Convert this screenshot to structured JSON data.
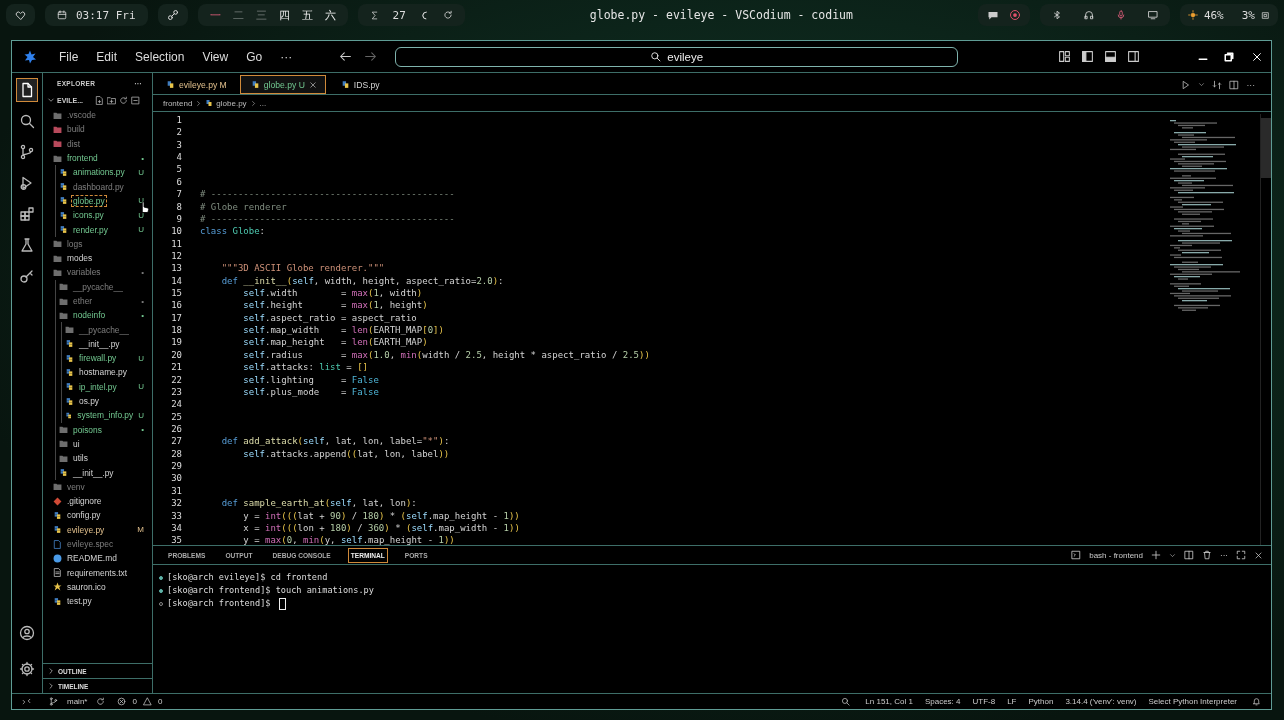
{
  "desktop_bar": {
    "clock": "03:17 Fri",
    "workspaces": [
      {
        "label": "一",
        "selected": true,
        "occupied": true
      },
      {
        "label": "二",
        "selected": false,
        "occupied": false
      },
      {
        "label": "三",
        "selected": false,
        "occupied": false
      },
      {
        "label": "四",
        "selected": false,
        "occupied": true
      },
      {
        "label": "五",
        "selected": false,
        "occupied": true
      },
      {
        "label": "六",
        "selected": false,
        "occupied": true
      }
    ],
    "counter": "27",
    "window_title": "globe.py - evileye - VSCodium - codium",
    "battery": "46%",
    "cpu": "3%"
  },
  "menu": [
    "File",
    "Edit",
    "Selection",
    "View",
    "Go",
    "···"
  ],
  "command_center": {
    "value": "evileye"
  },
  "activity_bar": [
    {
      "kind": "files",
      "selected": true
    },
    {
      "kind": "search",
      "selected": false
    },
    {
      "kind": "source-control",
      "selected": false
    },
    {
      "kind": "run",
      "selected": false
    },
    {
      "kind": "extensions",
      "selected": false
    },
    {
      "kind": "testing",
      "selected": false
    },
    {
      "kind": "remote",
      "selected": false
    }
  ],
  "activity_bar_bottom": [
    {
      "kind": "account"
    },
    {
      "kind": "settings"
    }
  ],
  "explorer": {
    "title": "EXPLORER",
    "more": "···",
    "root": "EVILE...",
    "tree": [
      {
        "name": ".vscode",
        "kind": "folder",
        "ignored": true,
        "untracked": false,
        "modified": false,
        "selected": false
      },
      {
        "name": "build",
        "kind": "buildfolder",
        "ignored": true,
        "untracked": false,
        "modified": false,
        "selected": false
      },
      {
        "name": "dist",
        "kind": "buildfolder",
        "ignored": true,
        "untracked": false,
        "modified": false,
        "selected": false
      },
      {
        "name": "frontend",
        "kind": "folder",
        "ignored": false,
        "untracked": true,
        "modified": false,
        "status": "•",
        "selected": false,
        "children": [
          {
            "name": "animations.py",
            "kind": "python",
            "ignored": false,
            "untracked": true,
            "modified": false,
            "status": "U",
            "selected": false
          },
          {
            "name": "dashboard.py",
            "kind": "python",
            "ignored": true,
            "untracked": false,
            "modified": false,
            "selected": false
          },
          {
            "name": "globe.py",
            "kind": "python",
            "ignored": false,
            "untracked": true,
            "modified": false,
            "status": "U",
            "selected": true
          },
          {
            "name": "icons.py",
            "kind": "python",
            "ignored": false,
            "untracked": true,
            "modified": false,
            "status": "U",
            "selected": false
          },
          {
            "name": "render.py",
            "kind": "python",
            "ignored": false,
            "untracked": true,
            "modified": false,
            "status": "U",
            "selected": false
          }
        ]
      },
      {
        "name": "logs",
        "kind": "folder",
        "ignored": true,
        "untracked": false,
        "modified": false,
        "selected": false
      },
      {
        "name": "modes",
        "kind": "folder",
        "ignored": false,
        "untracked": false,
        "modified": false,
        "selected": false
      },
      {
        "name": "variables",
        "kind": "folder",
        "ignored": true,
        "untracked": false,
        "modified": false,
        "status": "•",
        "selected": false,
        "children": [
          {
            "name": "__pycache__",
            "kind": "folder",
            "ignored": true,
            "untracked": false,
            "modified": false,
            "selected": false
          },
          {
            "name": "ether",
            "kind": "folder",
            "ignored": true,
            "untracked": false,
            "modified": false,
            "status": "•",
            "selected": false
          },
          {
            "name": "nodeinfo",
            "kind": "folder",
            "ignored": false,
            "untracked": true,
            "modified": false,
            "status": "•",
            "selected": false,
            "children": [
              {
                "name": "__pycache__",
                "kind": "folder",
                "ignored": true,
                "untracked": false,
                "modified": false,
                "selected": false
              },
              {
                "name": "__init__.py",
                "kind": "python",
                "ignored": false,
                "untracked": false,
                "modified": false,
                "selected": false
              },
              {
                "name": "firewall.py",
                "kind": "python",
                "ignored": false,
                "untracked": true,
                "modified": false,
                "status": "U",
                "selected": false
              },
              {
                "name": "hostname.py",
                "kind": "python",
                "ignored": false,
                "untracked": false,
                "modified": false,
                "selected": false
              },
              {
                "name": "ip_intel.py",
                "kind": "python",
                "ignored": false,
                "untracked": true,
                "modified": false,
                "status": "U",
                "selected": false
              },
              {
                "name": "os.py",
                "kind": "python",
                "ignored": false,
                "untracked": false,
                "modified": false,
                "selected": false
              },
              {
                "name": "system_info.py",
                "kind": "python",
                "ignored": false,
                "untracked": true,
                "modified": false,
                "status": "U",
                "selected": false
              }
            ]
          },
          {
            "name": "poisons",
            "kind": "folder",
            "ignored": false,
            "untracked": true,
            "modified": false,
            "status": "•",
            "selected": false
          },
          {
            "name": "ui",
            "kind": "folder",
            "ignored": false,
            "untracked": false,
            "modified": false,
            "selected": false
          },
          {
            "name": "utils",
            "kind": "folder",
            "ignored": false,
            "untracked": false,
            "modified": false,
            "selected": false
          },
          {
            "name": "__init__.py",
            "kind": "python",
            "ignored": false,
            "untracked": false,
            "modified": false,
            "selected": false
          }
        ]
      },
      {
        "name": "venv",
        "kind": "folder",
        "ignored": true,
        "untracked": false,
        "modified": false,
        "selected": false
      },
      {
        "name": ".gitignore",
        "kind": "git",
        "ignored": false,
        "untracked": false,
        "modified": false,
        "selected": false
      },
      {
        "name": "config.py",
        "kind": "python",
        "ignored": false,
        "untracked": false,
        "modified": false,
        "selected": false
      },
      {
        "name": "evileye.py",
        "kind": "python",
        "ignored": false,
        "untracked": false,
        "modified": true,
        "status": "M",
        "selected": false
      },
      {
        "name": "evileye.spec",
        "kind": "spec",
        "ignored": true,
        "untracked": false,
        "modified": false,
        "selected": false
      },
      {
        "name": "README.md",
        "kind": "markdown",
        "ignored": false,
        "untracked": false,
        "modified": false,
        "selected": false
      },
      {
        "name": "requirements.txt",
        "kind": "text",
        "ignored": false,
        "untracked": false,
        "modified": false,
        "selected": false
      },
      {
        "name": "sauron.ico",
        "kind": "image",
        "ignored": false,
        "untracked": false,
        "modified": false,
        "selected": false
      },
      {
        "name": "test.py",
        "kind": "python",
        "ignored": false,
        "untracked": false,
        "modified": false,
        "selected": false
      }
    ],
    "sections": [
      {
        "label": "OUTLINE",
        "expanded": false
      },
      {
        "label": "TIMELINE",
        "expanded": false
      }
    ]
  },
  "tabs": [
    {
      "label": "evileye.py",
      "status": "M",
      "untracked": false,
      "modified": true,
      "selected": false
    },
    {
      "label": "globe.py",
      "status": "U",
      "untracked": true,
      "modified": false,
      "selected": true
    },
    {
      "label": "IDS.py",
      "untracked": false,
      "modified": false,
      "selected": false
    }
  ],
  "breadcrumb": [
    "frontend",
    "globe.py",
    "..."
  ],
  "code": [
    {
      "n": "1"
    },
    {
      "n": "2"
    },
    {
      "n": "3"
    },
    {
      "n": "4"
    },
    {
      "n": "5"
    },
    {
      "n": "6"
    },
    {
      "n": "7",
      "tokens": [
        {
          "kind": "comment",
          "text": "# ---------------------------------------------"
        }
      ]
    },
    {
      "n": "8",
      "tokens": [
        {
          "kind": "comment",
          "text": "# Globe renderer"
        }
      ]
    },
    {
      "n": "9",
      "tokens": [
        {
          "kind": "comment",
          "text": "# ---------------------------------------------"
        }
      ]
    },
    {
      "n": "10",
      "tokens": [
        {
          "kind": "keyword",
          "text": "class "
        },
        {
          "kind": "class",
          "text": "Globe"
        },
        {
          "kind": "plain",
          "text": ":"
        }
      ]
    },
    {
      "n": "11"
    },
    {
      "n": "12"
    },
    {
      "n": "13",
      "tokens": [
        {
          "kind": "string",
          "text": "    \"\"\"3D ASCII Globe renderer.\"\"\""
        }
      ]
    },
    {
      "n": "14",
      "tokens": [
        {
          "kind": "keyword",
          "text": "    def "
        },
        {
          "kind": "function",
          "text": "__init__"
        },
        {
          "kind": "bracket",
          "text": "("
        },
        {
          "kind": "self",
          "text": "self"
        },
        {
          "kind": "plain",
          "text": ", width, height, aspect_ratio="
        },
        {
          "kind": "number",
          "text": "2.0"
        },
        {
          "kind": "bracket",
          "text": ")"
        },
        {
          "kind": "plain",
          "text": ":"
        }
      ]
    },
    {
      "n": "15",
      "tokens": [
        {
          "kind": "self",
          "text": "        self"
        },
        {
          "kind": "plain",
          "text": ".width        = "
        },
        {
          "kind": "builtin",
          "text": "max"
        },
        {
          "kind": "bracket",
          "text": "("
        },
        {
          "kind": "number",
          "text": "1"
        },
        {
          "kind": "plain",
          "text": ", width"
        },
        {
          "kind": "bracket",
          "text": ")"
        }
      ]
    },
    {
      "n": "16",
      "tokens": [
        {
          "kind": "self",
          "text": "        self"
        },
        {
          "kind": "plain",
          "text": ".height       = "
        },
        {
          "kind": "builtin",
          "text": "max"
        },
        {
          "kind": "bracket",
          "text": "("
        },
        {
          "kind": "number",
          "text": "1"
        },
        {
          "kind": "plain",
          "text": ", height"
        },
        {
          "kind": "bracket",
          "text": ")"
        }
      ]
    },
    {
      "n": "17",
      "tokens": [
        {
          "kind": "self",
          "text": "        self"
        },
        {
          "kind": "plain",
          "text": ".aspect_ratio = aspect_ratio"
        }
      ]
    },
    {
      "n": "18",
      "tokens": [
        {
          "kind": "self",
          "text": "        self"
        },
        {
          "kind": "plain",
          "text": ".map_width    = "
        },
        {
          "kind": "builtin",
          "text": "len"
        },
        {
          "kind": "bracket",
          "text": "("
        },
        {
          "kind": "plain",
          "text": "EARTH_MAP"
        },
        {
          "kind": "bracket",
          "text": "["
        },
        {
          "kind": "number",
          "text": "0"
        },
        {
          "kind": "bracket",
          "text": "])"
        }
      ]
    },
    {
      "n": "19",
      "tokens": [
        {
          "kind": "self",
          "text": "        self"
        },
        {
          "kind": "plain",
          "text": ".map_height   = "
        },
        {
          "kind": "builtin",
          "text": "len"
        },
        {
          "kind": "bracket",
          "text": "("
        },
        {
          "kind": "plain",
          "text": "EARTH_MAP"
        },
        {
          "kind": "bracket",
          "text": ")"
        }
      ]
    },
    {
      "n": "20",
      "tokens": [
        {
          "kind": "self",
          "text": "        self"
        },
        {
          "kind": "plain",
          "text": ".radius       = "
        },
        {
          "kind": "builtin",
          "text": "max"
        },
        {
          "kind": "bracket",
          "text": "("
        },
        {
          "kind": "number",
          "text": "1.0"
        },
        {
          "kind": "plain",
          "text": ", "
        },
        {
          "kind": "builtin",
          "text": "min"
        },
        {
          "kind": "bracket",
          "text": "("
        },
        {
          "kind": "plain",
          "text": "width / "
        },
        {
          "kind": "number",
          "text": "2.5"
        },
        {
          "kind": "plain",
          "text": ", height * aspect_ratio / "
        },
        {
          "kind": "number",
          "text": "2.5"
        },
        {
          "kind": "bracket",
          "text": "))"
        }
      ]
    },
    {
      "n": "21",
      "tokens": [
        {
          "kind": "self",
          "text": "        self"
        },
        {
          "kind": "plain",
          "text": ".attacks: "
        },
        {
          "kind": "class",
          "text": "list"
        },
        {
          "kind": "plain",
          "text": " = "
        },
        {
          "kind": "bracket",
          "text": "[]"
        }
      ]
    },
    {
      "n": "22",
      "tokens": [
        {
          "kind": "self",
          "text": "        self"
        },
        {
          "kind": "plain",
          "text": ".lighting     = "
        },
        {
          "kind": "constant",
          "text": "False"
        }
      ]
    },
    {
      "n": "23",
      "tokens": [
        {
          "kind": "self",
          "text": "        self"
        },
        {
          "kind": "plain",
          "text": ".plus_mode    = "
        },
        {
          "kind": "constant",
          "text": "False"
        }
      ]
    },
    {
      "n": "24"
    },
    {
      "n": "25"
    },
    {
      "n": "26"
    },
    {
      "n": "27",
      "tokens": [
        {
          "kind": "keyword",
          "text": "    def "
        },
        {
          "kind": "function",
          "text": "add_attack"
        },
        {
          "kind": "bracket",
          "text": "("
        },
        {
          "kind": "self",
          "text": "self"
        },
        {
          "kind": "plain",
          "text": ", lat, lon, label="
        },
        {
          "kind": "string",
          "text": "\"*\""
        },
        {
          "kind": "bracket",
          "text": ")"
        },
        {
          "kind": "plain",
          "text": ":"
        }
      ]
    },
    {
      "n": "28",
      "tokens": [
        {
          "kind": "self",
          "text": "        self"
        },
        {
          "kind": "plain",
          "text": ".attacks.append"
        },
        {
          "kind": "bracket",
          "text": "(("
        },
        {
          "kind": "plain",
          "text": "lat, lon, label"
        },
        {
          "kind": "bracket",
          "text": "))"
        }
      ]
    },
    {
      "n": "29"
    },
    {
      "n": "30"
    },
    {
      "n": "31"
    },
    {
      "n": "32",
      "tokens": [
        {
          "kind": "keyword",
          "text": "    def "
        },
        {
          "kind": "function",
          "text": "sample_earth_at"
        },
        {
          "kind": "bracket",
          "text": "("
        },
        {
          "kind": "self",
          "text": "self"
        },
        {
          "kind": "plain",
          "text": ", lat, lon"
        },
        {
          "kind": "bracket",
          "text": ")"
        },
        {
          "kind": "plain",
          "text": ":"
        }
      ]
    },
    {
      "n": "33",
      "tokens": [
        {
          "kind": "plain",
          "text": "        y = "
        },
        {
          "kind": "builtin",
          "text": "int"
        },
        {
          "kind": "bracket",
          "text": "((("
        },
        {
          "kind": "plain",
          "text": "lat + "
        },
        {
          "kind": "number",
          "text": "90"
        },
        {
          "kind": "bracket",
          "text": ")"
        },
        {
          "kind": "plain",
          "text": " / "
        },
        {
          "kind": "number",
          "text": "180"
        },
        {
          "kind": "bracket",
          "text": ")"
        },
        {
          "kind": "plain",
          "text": " * "
        },
        {
          "kind": "bracket",
          "text": "("
        },
        {
          "kind": "self",
          "text": "self"
        },
        {
          "kind": "plain",
          "text": ".map_height - "
        },
        {
          "kind": "number",
          "text": "1"
        },
        {
          "kind": "bracket",
          "text": "))"
        }
      ]
    },
    {
      "n": "34",
      "tokens": [
        {
          "kind": "plain",
          "text": "        x = "
        },
        {
          "kind": "builtin",
          "text": "int"
        },
        {
          "kind": "bracket",
          "text": "((("
        },
        {
          "kind": "plain",
          "text": "lon + "
        },
        {
          "kind": "number",
          "text": "180"
        },
        {
          "kind": "bracket",
          "text": ")"
        },
        {
          "kind": "plain",
          "text": " / "
        },
        {
          "kind": "number",
          "text": "360"
        },
        {
          "kind": "bracket",
          "text": ")"
        },
        {
          "kind": "plain",
          "text": " * "
        },
        {
          "kind": "bracket",
          "text": "("
        },
        {
          "kind": "self",
          "text": "self"
        },
        {
          "kind": "plain",
          "text": ".map_width - "
        },
        {
          "kind": "number",
          "text": "1"
        },
        {
          "kind": "bracket",
          "text": "))"
        }
      ]
    },
    {
      "n": "35",
      "tokens": [
        {
          "kind": "plain",
          "text": "        y = "
        },
        {
          "kind": "builtin",
          "text": "max"
        },
        {
          "kind": "bracket",
          "text": "("
        },
        {
          "kind": "number",
          "text": "0"
        },
        {
          "kind": "plain",
          "text": ", "
        },
        {
          "kind": "builtin",
          "text": "min"
        },
        {
          "kind": "bracket",
          "text": "("
        },
        {
          "kind": "plain",
          "text": "y, "
        },
        {
          "kind": "self",
          "text": "self"
        },
        {
          "kind": "plain",
          "text": ".map_height - "
        },
        {
          "kind": "number",
          "text": "1"
        },
        {
          "kind": "bracket",
          "text": "))"
        }
      ]
    }
  ],
  "panel": {
    "tabs": [
      {
        "label": "PROBLEMS",
        "selected": false
      },
      {
        "label": "OUTPUT",
        "selected": false
      },
      {
        "label": "DEBUG CONSOLE",
        "selected": false
      },
      {
        "label": "TERMINAL",
        "selected": true
      },
      {
        "label": "PORTS",
        "selected": false
      }
    ],
    "terminal_name": "bash - frontend",
    "lines": [
      {
        "text": "[sko@arch evileye]$ cd frontend",
        "completed": true
      },
      {
        "text": "[sko@arch frontend]$ touch animations.py",
        "completed": true
      },
      {
        "text": "[sko@arch frontend]$",
        "completed": false,
        "cursor": true
      }
    ]
  },
  "status_bar": {
    "branch": "main*",
    "errors": "0",
    "warnings": "0",
    "items": [
      "Ln 151, Col 1",
      "Spaces: 4",
      "UTF-8",
      "LF",
      "Python",
      "3.14.4 ('venv': venv)",
      "Select Python Interpreter"
    ]
  }
}
